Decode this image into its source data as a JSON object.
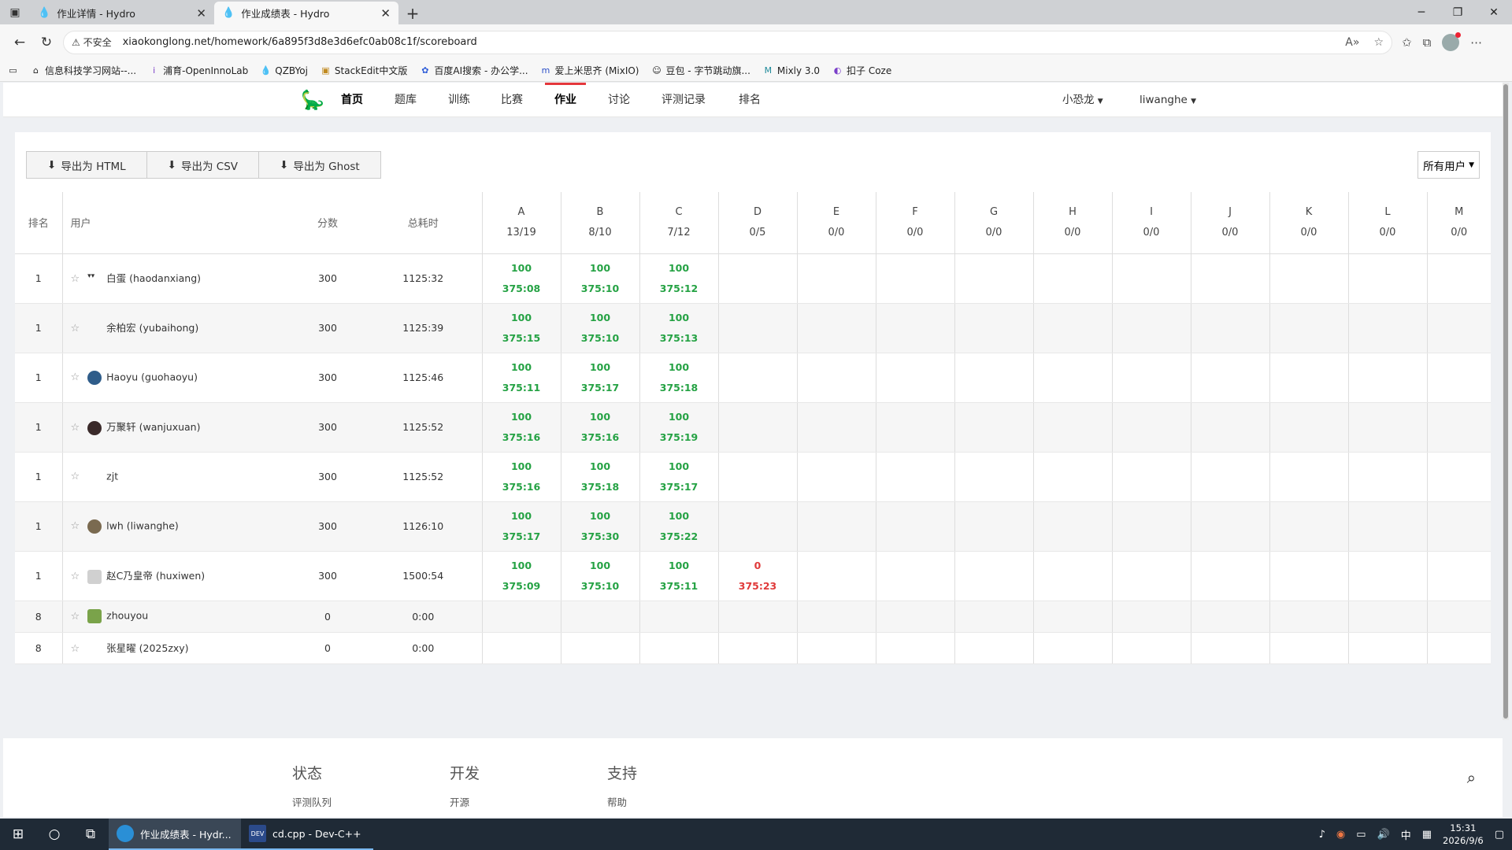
{
  "browser": {
    "tabs": [
      {
        "title": "作业详情 - Hydro",
        "active": false
      },
      {
        "title": "作业成绩表 - Hydro",
        "active": true
      }
    ],
    "security_label": "不安全",
    "url": "xiaokonglong.net/homework/6a895f3d8e3d6efc0ab08c1f/scoreboard",
    "favorites": [
      "信息科技学习网站--...",
      "浦育-OpenInnoLab",
      "QZBYoj",
      "StackEdit中文版",
      "百度AI搜索 - 办公学...",
      "爱上米思齐 (MixIO)",
      "豆包 - 字节跳动旗...",
      "Mixly 3.0",
      "扣子 Coze"
    ]
  },
  "site": {
    "nav": [
      "首页",
      "题库",
      "训练",
      "比赛",
      "作业",
      "讨论",
      "评测记录",
      "排名"
    ],
    "active_nav": "作业",
    "user_menu_1": "小恐龙",
    "user_menu_2": "liwanghe"
  },
  "scoreboard": {
    "export_buttons": [
      "导出为 HTML",
      "导出为 CSV",
      "导出为 Ghost"
    ],
    "filter_label": "所有用户",
    "headers": {
      "rank": "排名",
      "user": "用户",
      "score": "分数",
      "time": "总耗时"
    },
    "problems": [
      {
        "id": "A",
        "stat": "13/19"
      },
      {
        "id": "B",
        "stat": "8/10"
      },
      {
        "id": "C",
        "stat": "7/12"
      },
      {
        "id": "D",
        "stat": "0/5"
      },
      {
        "id": "E",
        "stat": "0/0"
      },
      {
        "id": "F",
        "stat": "0/0"
      },
      {
        "id": "G",
        "stat": "0/0"
      },
      {
        "id": "H",
        "stat": "0/0"
      },
      {
        "id": "I",
        "stat": "0/0"
      },
      {
        "id": "J",
        "stat": "0/0"
      },
      {
        "id": "K",
        "stat": "0/0"
      },
      {
        "id": "L",
        "stat": "0/0"
      },
      {
        "id": "M",
        "stat": "0/0"
      }
    ],
    "rows": [
      {
        "rank": "1",
        "user": "白蛋 (haodanxiang)",
        "score": "300",
        "time": "1125:32",
        "cells": [
          [
            "100",
            "375:08"
          ],
          [
            "100",
            "375:10"
          ],
          [
            "100",
            "375:12"
          ]
        ]
      },
      {
        "rank": "1",
        "user": "余柏宏 (yubaihong)",
        "score": "300",
        "time": "1125:39",
        "cells": [
          [
            "100",
            "375:15"
          ],
          [
            "100",
            "375:10"
          ],
          [
            "100",
            "375:13"
          ]
        ]
      },
      {
        "rank": "1",
        "user": "Haoyu (guohaoyu)",
        "score": "300",
        "time": "1125:46",
        "cells": [
          [
            "100",
            "375:11"
          ],
          [
            "100",
            "375:17"
          ],
          [
            "100",
            "375:18"
          ]
        ]
      },
      {
        "rank": "1",
        "user": "万聚轩 (wanjuxuan)",
        "score": "300",
        "time": "1125:52",
        "cells": [
          [
            "100",
            "375:16"
          ],
          [
            "100",
            "375:16"
          ],
          [
            "100",
            "375:19"
          ]
        ]
      },
      {
        "rank": "1",
        "user": "zjt",
        "score": "300",
        "time": "1125:52",
        "cells": [
          [
            "100",
            "375:16"
          ],
          [
            "100",
            "375:18"
          ],
          [
            "100",
            "375:17"
          ]
        ]
      },
      {
        "rank": "1",
        "user": "lwh (liwanghe)",
        "score": "300",
        "time": "1126:10",
        "cells": [
          [
            "100",
            "375:17"
          ],
          [
            "100",
            "375:30"
          ],
          [
            "100",
            "375:22"
          ]
        ]
      },
      {
        "rank": "1",
        "user": "赵C乃皇帝 (huxiwen)",
        "score": "300",
        "time": "1500:54",
        "cells": [
          [
            "100",
            "375:09"
          ],
          [
            "100",
            "375:10"
          ],
          [
            "100",
            "375:11"
          ],
          [
            "0",
            "375:23"
          ]
        ]
      },
      {
        "rank": "8",
        "user": "zhouyou",
        "score": "0",
        "time": "0:00",
        "cells": []
      },
      {
        "rank": "8",
        "user": "张星曜 (2025zxy)",
        "score": "0",
        "time": "0:00",
        "cells": []
      }
    ]
  },
  "footer": {
    "col1_title": "状态",
    "col1_link": "评测队列",
    "col2_title": "开发",
    "col2_link": "开源",
    "col3_title": "支持",
    "col3_link": "帮助"
  },
  "taskbar": {
    "app1": "作业成绩表 - Hydr...",
    "app2": "cd.cpp - Dev-C++",
    "ime": "中",
    "time": "15:31",
    "date": "2026/9/6"
  },
  "colors": {
    "accept": "#25a244",
    "reject": "#e03a3a",
    "nav_active": "#e5373c"
  }
}
